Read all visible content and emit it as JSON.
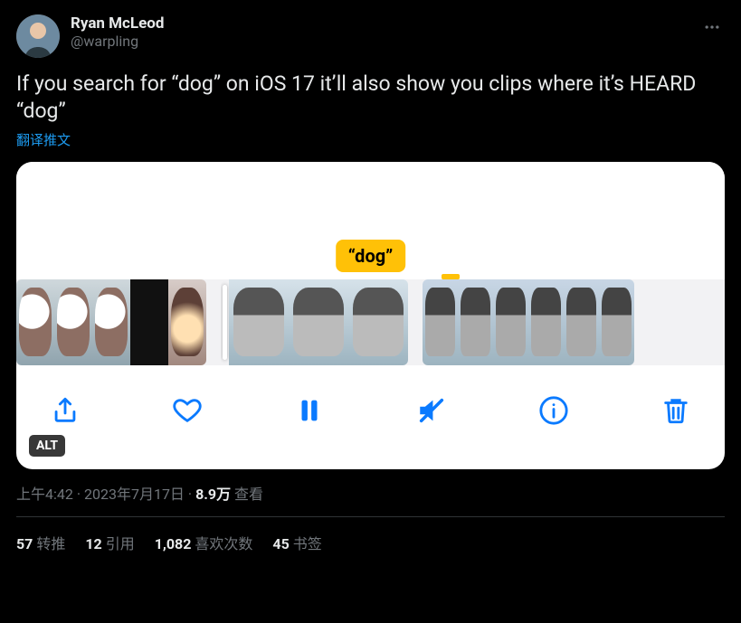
{
  "user": {
    "display_name": "Ryan McLeod",
    "handle": "@warpling"
  },
  "tweet_text": "If you search for “dog” on iOS 17 it’ll also show you clips where it’s HEARD “dog”",
  "translate_label": "翻译推文",
  "media": {
    "search_term_label": "“dog”",
    "alt_badge": "ALT"
  },
  "meta": {
    "time": "上午4:42",
    "sep": " · ",
    "date": "2023年7月17日",
    "views_num": "8.9万",
    "views_label": " 查看"
  },
  "stats": {
    "retweets_num": "57",
    "retweets_label": "转推",
    "quotes_num": "12",
    "quotes_label": "引用",
    "likes_num": "1,082",
    "likes_label": "喜欢次数",
    "bookmarks_num": "45",
    "bookmarks_label": "书签"
  }
}
